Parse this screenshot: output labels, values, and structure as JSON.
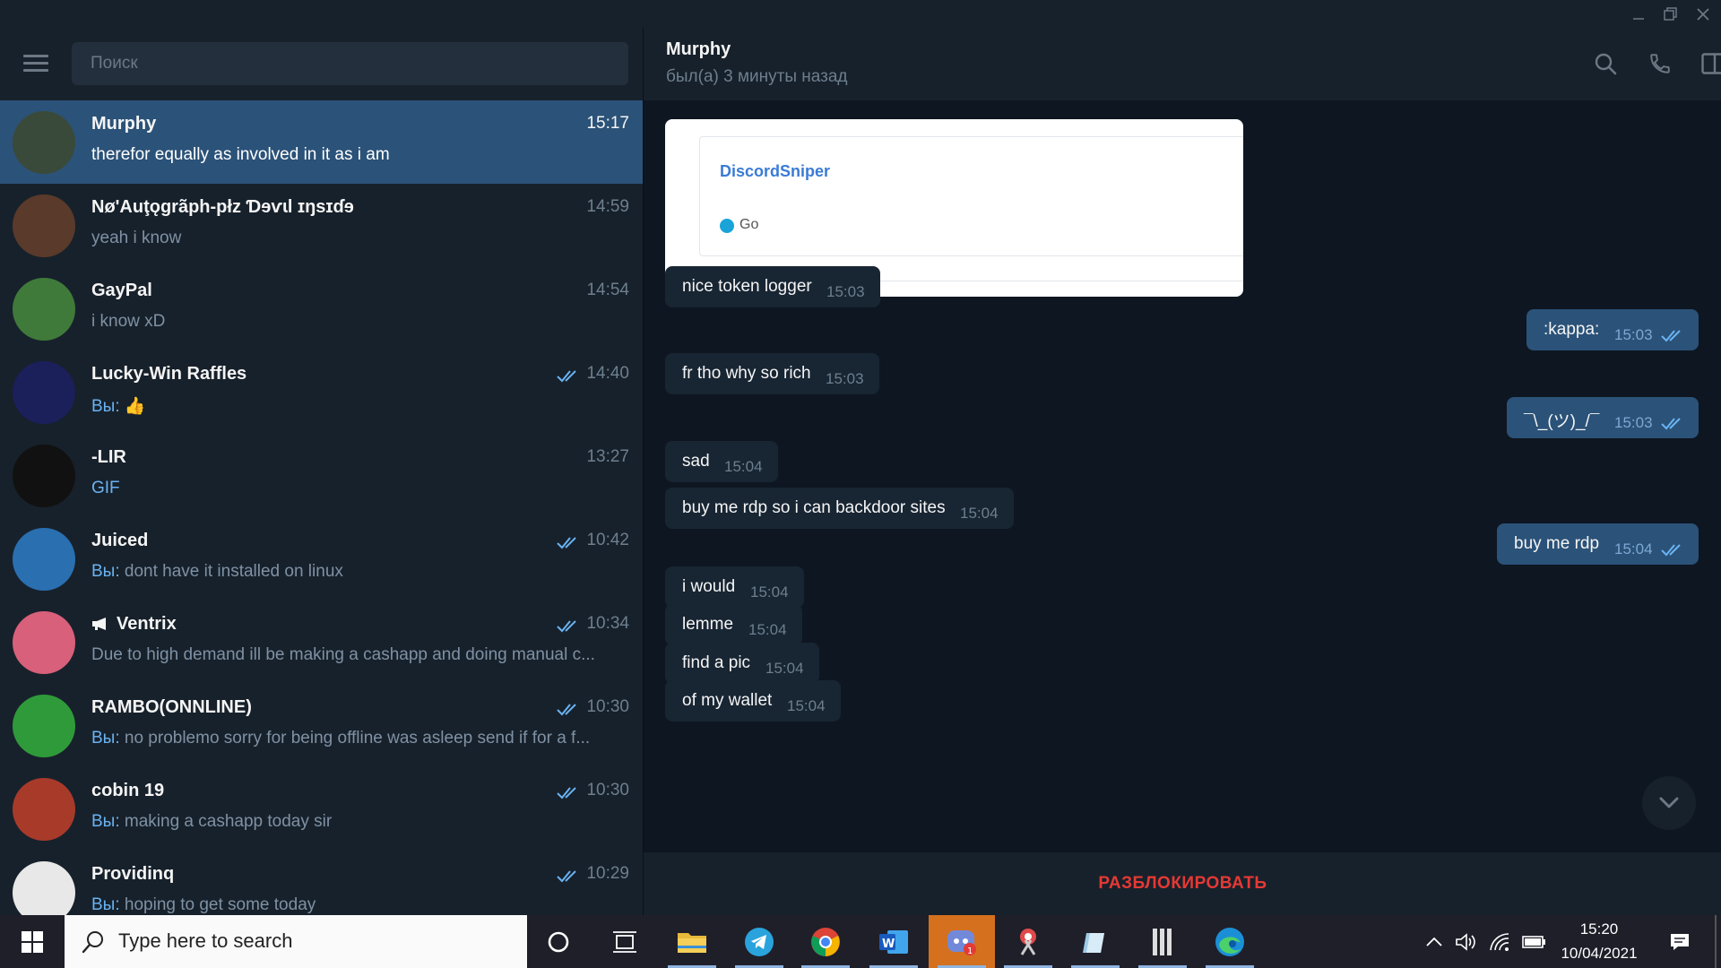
{
  "window": {
    "colors": {
      "bg": "#0e1621",
      "panel": "#17212b",
      "accent": "#2b5278",
      "link": "#6ab3f3",
      "danger": "#e53935"
    },
    "controls": [
      "minimize-icon",
      "restore-icon",
      "close-icon"
    ]
  },
  "sidebar": {
    "search_placeholder": "Поиск",
    "chats": [
      {
        "name": "Murphy",
        "time": "15:17",
        "message": "therefor equally as involved in it as i am",
        "you": false,
        "ticks": false,
        "active": true,
        "avatar_color": "#3a4a3a"
      },
      {
        "name": "Nø'Auţǫgrãph-płz Ɗɘѵɩl ɪŋsɪɗɘ",
        "time": "14:59",
        "message": "yeah i know",
        "you": false,
        "ticks": false,
        "avatar_color": "#5a3a2a"
      },
      {
        "name": "GayPal",
        "time": "14:54",
        "message": "i know xD",
        "you": false,
        "ticks": false,
        "avatar_color": "#3f7a3a"
      },
      {
        "name": "Lucky-Win Raffles",
        "time": "14:40",
        "message": "👍",
        "you": true,
        "you_label": "Вы:",
        "ticks": true,
        "avatar_color": "#1b1f5a"
      },
      {
        "name": "-LIR",
        "time": "13:27",
        "message": "GIF",
        "you": false,
        "ticks": false,
        "gif": true,
        "avatar_color": "#111111"
      },
      {
        "name": "Juiced",
        "time": "10:42",
        "message": "dont have it installed on linux",
        "you": true,
        "you_label": "Вы:",
        "ticks": true,
        "avatar_color": "#2a6fb0"
      },
      {
        "name": "Ventrix",
        "time": "10:34",
        "message": "Due to high demand ill be making a cashapp and doing manual c...",
        "you": false,
        "ticks": true,
        "channel": true,
        "avatar_color": "#d8607a"
      },
      {
        "name": "RAMBO(ONNLINE)",
        "time": "10:30",
        "message": "no problemo sorry for being offline was asleep send if for a f...",
        "you": true,
        "you_label": "Вы:",
        "ticks": true,
        "avatar_color": "#2f9a3a"
      },
      {
        "name": "cobin 19",
        "time": "10:30",
        "message": "making a cashapp today sir",
        "you": true,
        "you_label": "Вы:",
        "ticks": true,
        "avatar_color": "#a83a2a"
      },
      {
        "name": "Providinq",
        "time": "10:29",
        "message": "hoping to get some today",
        "you": true,
        "you_label": "Вы:",
        "ticks": true,
        "avatar_color": "#e8e8e8"
      }
    ]
  },
  "chat": {
    "peer_name": "Murphy",
    "peer_status": "был(а) 3 минуты назад",
    "header_icons": [
      "search-icon",
      "phone-icon",
      "sidebar-toggle-icon",
      "more-icon"
    ],
    "link_preview": {
      "title": "DiscordSniper",
      "status": "Go"
    },
    "messages": [
      {
        "dir": "in",
        "text": "nice token logger",
        "time": "15:03"
      },
      {
        "dir": "out",
        "text": ":kappa:",
        "time": "15:03"
      },
      {
        "dir": "in",
        "text": "fr tho why so rich",
        "time": "15:03"
      },
      {
        "dir": "out",
        "text": "¯\\_(ツ)_/¯",
        "time": "15:03"
      },
      {
        "dir": "in",
        "text": "sad",
        "time": "15:04"
      },
      {
        "dir": "in",
        "text": "buy me rdp so i can backdoor sites",
        "time": "15:04"
      },
      {
        "dir": "out",
        "text": "buy me rdp",
        "time": "15:04"
      },
      {
        "dir": "in",
        "text": "i would",
        "time": "15:04"
      },
      {
        "dir": "in",
        "text": "lemme",
        "time": "15:04"
      },
      {
        "dir": "in",
        "text": "find a pic",
        "time": "15:04"
      },
      {
        "dir": "in",
        "text": "of my wallet",
        "time": "15:04"
      }
    ],
    "unblock_label": "РАЗБЛОКИРОВАТЬ"
  },
  "taskbar": {
    "search_placeholder": "Type here to search",
    "apps": [
      "cortana-icon",
      "task-view-icon",
      "file-explorer-icon",
      "telegram-icon",
      "chrome-icon",
      "word-icon",
      "discord-icon",
      "snipping-icon",
      "notes-icon",
      "app-icon",
      "edge-icon"
    ],
    "discord_badge": "1",
    "time": "15:20",
    "date": "10/04/2021"
  }
}
